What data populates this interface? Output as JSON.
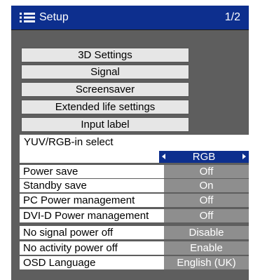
{
  "header": {
    "title": "Setup",
    "page": "1/2",
    "icon": "menu-list-icon"
  },
  "colors": {
    "title_bar": "#0d2f8e",
    "panel_bg": "#5e5e5e",
    "value_bg": "#8e8e8e",
    "button_bg": "#e6e6e6",
    "selected_value_bg": "#0d2f8e"
  },
  "menu_buttons": [
    {
      "label": "3D Settings"
    },
    {
      "label": "Signal"
    },
    {
      "label": "Screensaver"
    },
    {
      "label": "Extended life settings"
    },
    {
      "label": "Input label"
    }
  ],
  "yuv_rgb": {
    "label": "YUV/RGB-in select",
    "value": "RGB"
  },
  "settings": [
    {
      "label": "Power save",
      "value": "Off"
    },
    {
      "label": "Standby save",
      "value": "On"
    },
    {
      "label": "PC Power management",
      "value": "Off"
    },
    {
      "label": "DVI-D Power management",
      "value": "Off"
    },
    {
      "label": "No signal power off",
      "value": "Disable"
    },
    {
      "label": "No activity power off",
      "value": "Enable"
    },
    {
      "label": "OSD Language",
      "value": "English (UK)"
    }
  ]
}
